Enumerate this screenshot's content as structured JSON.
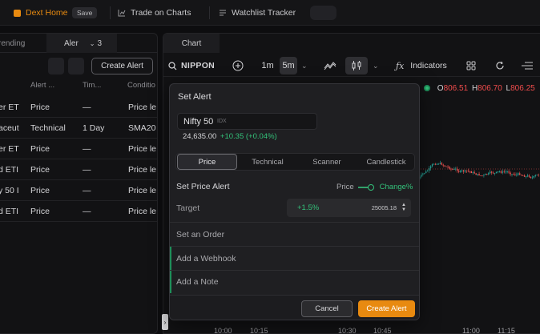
{
  "topbar": {
    "home_label": "Dext Home",
    "save_label": "Save",
    "trade_label": "Trade on Charts",
    "watchlist_label": "Watchlist Tracker"
  },
  "left_panel": {
    "tab_trending": "rending",
    "tab_alerts": "Aler",
    "tab_count": "3",
    "create_alert_label": "Create Alert",
    "headers": [
      "Alert ...",
      "Tim...",
      "Conditio"
    ],
    "rows": [
      {
        "name": "er ET",
        "type": "Price",
        "time": "—",
        "cond": "Price le"
      },
      {
        "name": "aceut",
        "type": "Technical",
        "time": "1 Day",
        "cond": "SMA20"
      },
      {
        "name": "er ET",
        "type": "Price",
        "time": "—",
        "cond": "Price le"
      },
      {
        "name": "d ETI",
        "type": "Price",
        "time": "—",
        "cond": "Price le"
      },
      {
        "name": "y 50 I",
        "type": "Price",
        "time": "—",
        "cond": "Price le"
      },
      {
        "name": "d ETI",
        "type": "Price",
        "time": "—",
        "cond": "Price le"
      }
    ]
  },
  "chart": {
    "tab_label": "Chart",
    "symbol": "NIPPON",
    "intervals": [
      "1m",
      "5m"
    ],
    "indicators_label": "Indicators",
    "ohlc": {
      "o_label": "O",
      "o": "806.51",
      "h_label": "H",
      "h": "806.70",
      "l_label": "L",
      "l": "806.25"
    },
    "x_ticks": [
      "10:00",
      "10:15",
      "10:30",
      "10:45",
      "11:00",
      "11:15"
    ],
    "colors": {
      "up": "#26a69a",
      "down": "#ef5350",
      "accent": "#e88a10"
    }
  },
  "modal": {
    "title": "Set Alert",
    "instrument": {
      "name": "Nifty 50",
      "exchange": "IDX",
      "price": "24,635.00",
      "change": "+10.35 (+0.04%)"
    },
    "tabs": [
      "Price",
      "Technical",
      "Scanner",
      "Candlestick"
    ],
    "active_tab": "Price",
    "section_title": "Set Price Alert",
    "toggle": {
      "left": "Price",
      "right": "Change%"
    },
    "target_label": "Target",
    "target_pct": "+1.5%",
    "target_value": "25005.18",
    "order_label": "Set an Order",
    "webhook_label": "Add a Webhook",
    "note_label": "Add a Note",
    "cancel_label": "Cancel",
    "create_label": "Create Alert"
  }
}
